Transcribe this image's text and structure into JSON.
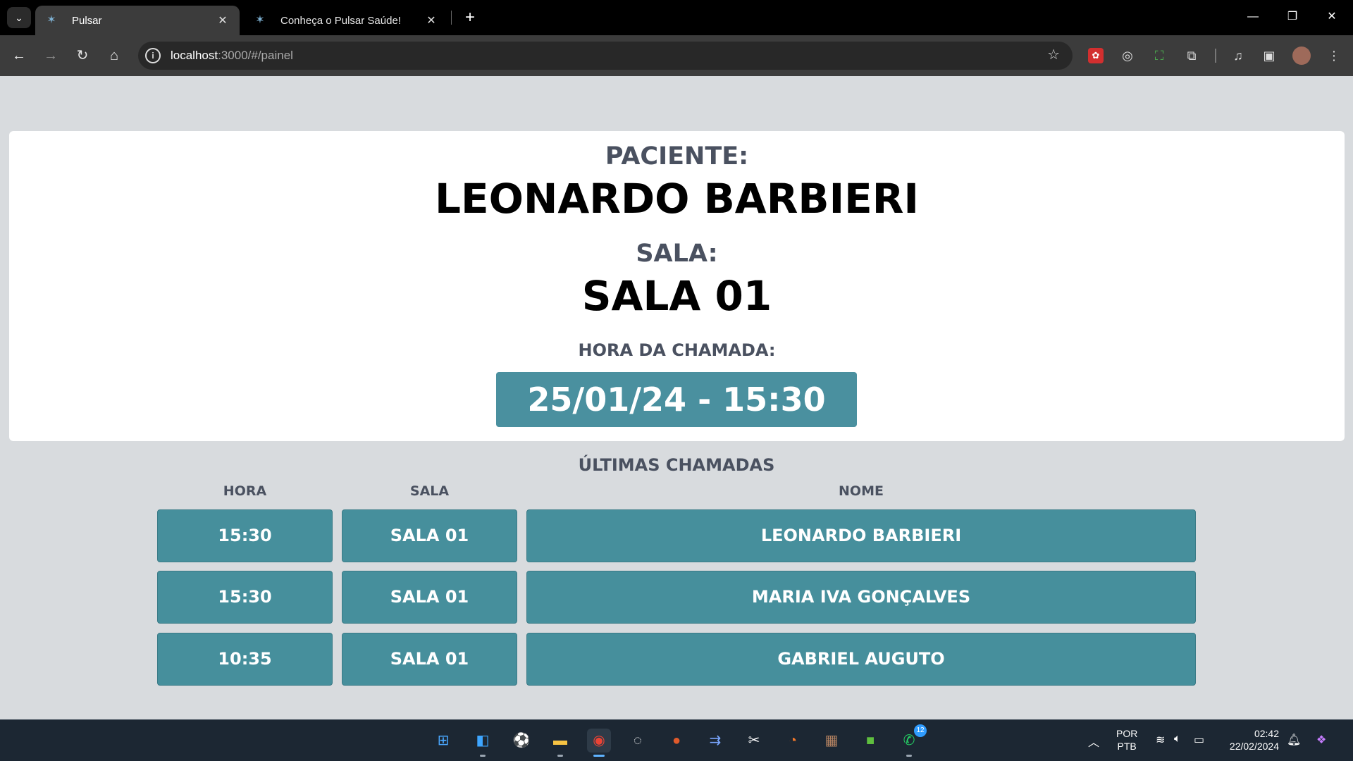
{
  "browser": {
    "tabs": [
      {
        "title": "Pulsar",
        "active": true
      },
      {
        "title": "Conheça o Pulsar Saúde!",
        "active": false
      }
    ],
    "url_host": "localhost",
    "url_rest": ":3000/#/painel"
  },
  "panel": {
    "patient_label": "PACIENTE:",
    "patient_name": "LEONARDO BARBIERI",
    "room_label": "SALA:",
    "room_value": "SALA 01",
    "call_time_label": "HORA DA CHAMADA:",
    "call_time_value": "25/01/24 - 15:30"
  },
  "history": {
    "title": "ÚLTIMAS CHAMADAS",
    "columns": [
      "HORA",
      "SALA",
      "NOME"
    ],
    "rows": [
      {
        "hora": "15:30",
        "sala": "SALA 01",
        "nome": "LEONARDO BARBIERI"
      },
      {
        "hora": "15:30",
        "sala": "SALA 01",
        "nome": "MARIA IVA GONÇALVES"
      },
      {
        "hora": "10:35",
        "sala": "SALA 01",
        "nome": "GABRIEL AUGUTO"
      }
    ]
  },
  "taskbar": {
    "whatsapp_badge": "12",
    "lang_line1": "POR",
    "lang_line2": "PTB",
    "time": "02:42",
    "date": "22/02/2024"
  },
  "colors": {
    "accent_teal": "#468f9c",
    "page_bg": "#d8dbde",
    "label_gray": "#4a5160"
  }
}
